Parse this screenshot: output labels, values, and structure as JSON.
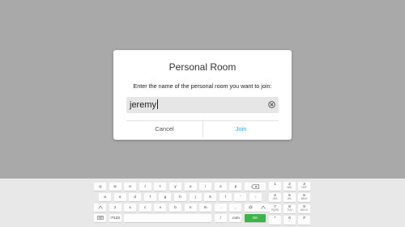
{
  "dialog": {
    "title": "Personal Room",
    "prompt": "Enter the name of the personal room you want to join:",
    "input_value": "jeremy",
    "cancel_label": "Cancel",
    "join_label": "Join"
  },
  "keyboard": {
    "row1": [
      "q",
      "w",
      "e",
      "r",
      "t",
      "y",
      "u",
      "i",
      "o",
      "p"
    ],
    "row2": [
      "a",
      "s",
      "d",
      "f",
      "g",
      "h",
      "j",
      "k",
      "l",
      "'",
      "-"
    ],
    "row3": [
      "z",
      "x",
      "c",
      "v",
      "b",
      "n",
      "m",
      ".",
      ",",
      "@"
    ],
    "symbols_label": "!?123",
    "slash_label": "/",
    "dotcom_label": ".com",
    "ok_label": "OK",
    "numpad": [
      {
        "digit": "1",
        "letters": ""
      },
      {
        "digit": "2",
        "letters": "ABC"
      },
      {
        "digit": "3",
        "letters": "DEF"
      },
      {
        "digit": "4",
        "letters": "GHI"
      },
      {
        "digit": "5",
        "letters": "JKL"
      },
      {
        "digit": "6",
        "letters": "MNO"
      },
      {
        "digit": "7",
        "letters": "PQRS"
      },
      {
        "digit": "8",
        "letters": "TUV"
      },
      {
        "digit": "9",
        "letters": "WXYZ"
      },
      {
        "digit": "*",
        "letters": ""
      },
      {
        "digit": "0",
        "letters": "+"
      },
      {
        "digit": "#",
        "letters": ""
      }
    ],
    "icons": {
      "backspace": "backspace-icon",
      "shift": "shift-icon",
      "hide_keyboard": "keyboard-icon"
    },
    "colors": {
      "ok": "#39b54a",
      "join": "#2fa7da"
    }
  }
}
